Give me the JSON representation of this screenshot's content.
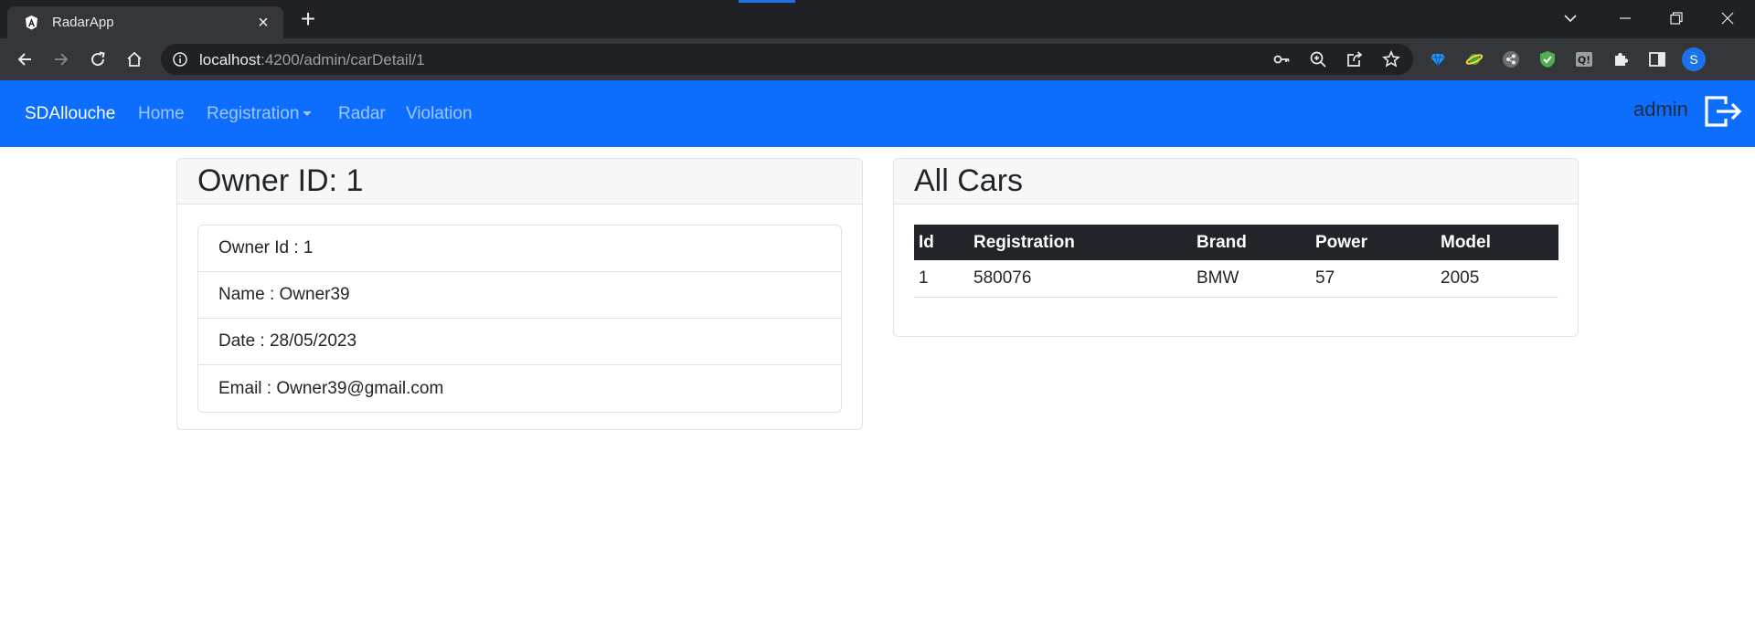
{
  "browser": {
    "tab_title": "RadarApp",
    "url_host": "localhost",
    "url_rest": ":4200/admin/carDetail/1",
    "profile_initial": "S"
  },
  "navbar": {
    "brand": "SDAllouche",
    "links": [
      "Home",
      "Registration",
      "Radar",
      "Violation"
    ],
    "user": "admin"
  },
  "owner_card": {
    "title": "Owner ID: 1",
    "fields": [
      "Owner Id : 1",
      "Name : Owner39",
      "Date : 28/05/2023",
      "Email : Owner39@gmail.com"
    ]
  },
  "cars_card": {
    "title": "All Cars",
    "columns": [
      "Id",
      "Registration",
      "Brand",
      "Power",
      "Model"
    ],
    "rows": [
      [
        "1",
        "580076",
        "BMW",
        "57",
        "2005"
      ]
    ]
  },
  "colors": {
    "navbar_bg": "#0d6efd",
    "chrome_dark": "#202124",
    "table_header_bg": "#212529"
  }
}
